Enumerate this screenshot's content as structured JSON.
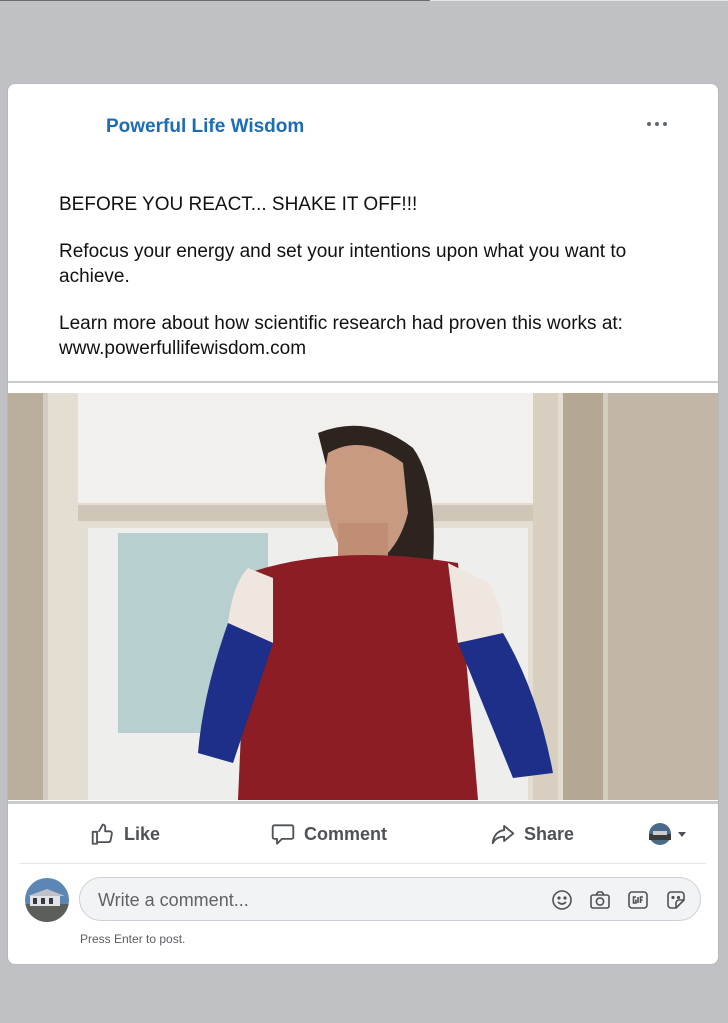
{
  "post": {
    "page_name": "Powerful Life Wisdom",
    "lines": [
      "BEFORE YOU REACT... SHAKE IT OFF!!!",
      "Refocus your energy and set your intentions upon what you want to achieve.",
      "Learn more about how scientific research had proven this works at: www.powerfullifewisdom.com"
    ]
  },
  "actions": {
    "like": "Like",
    "comment": "Comment",
    "share": "Share"
  },
  "comment": {
    "placeholder": "Write a comment...",
    "hint": "Press Enter to post.",
    "icons": [
      "emoji-icon",
      "camera-icon",
      "gif-icon",
      "sticker-icon"
    ]
  },
  "colors": {
    "page_name": "#1a6db6",
    "background": "#c0c1c4",
    "action_text": "#4f5257"
  }
}
